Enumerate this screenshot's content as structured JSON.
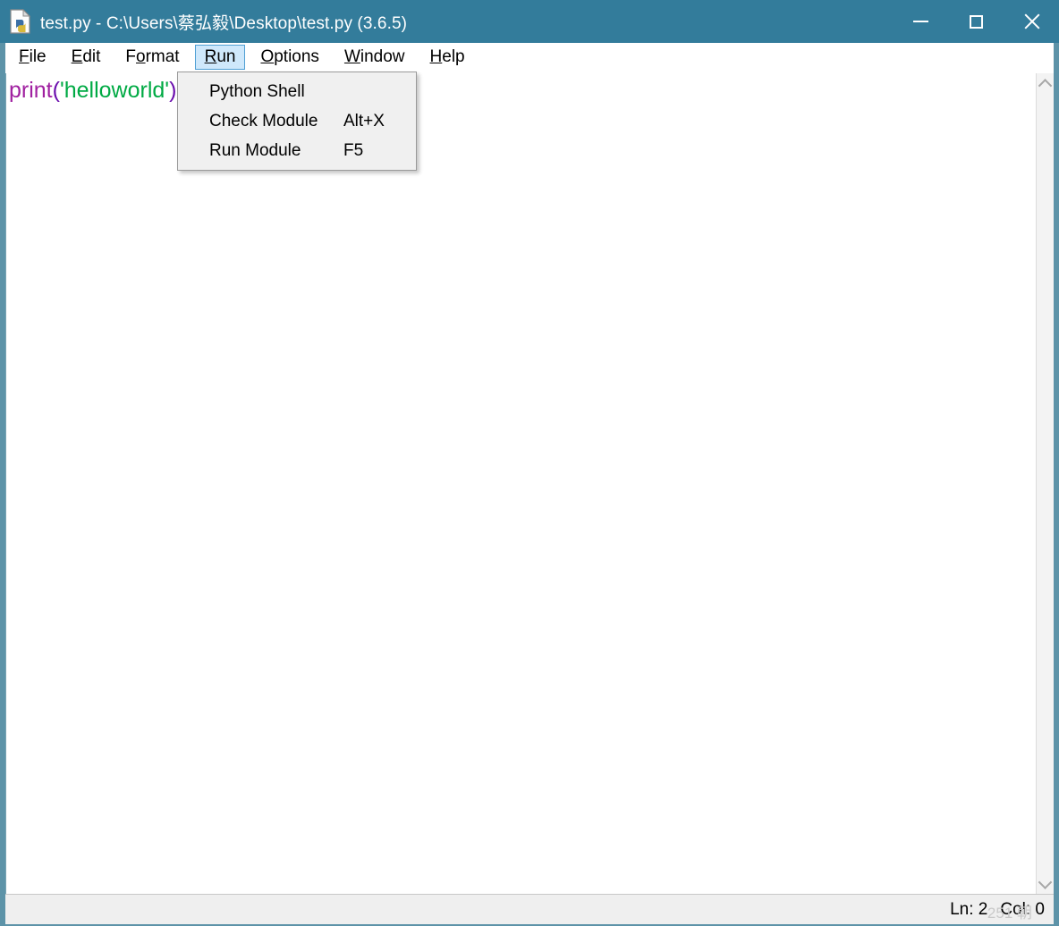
{
  "window": {
    "title": "test.py - C:\\Users\\蔡弘毅\\Desktop\\test.py (3.6.5)",
    "icon": "python-file-icon",
    "titlebar_color": "#337c9b",
    "controls": {
      "minimize_label": "—",
      "maximize_label": "☐",
      "close_label": "✕"
    }
  },
  "menubar": {
    "items": [
      {
        "label": "File",
        "accel": "F",
        "active": false
      },
      {
        "label": "Edit",
        "accel": "E",
        "active": false
      },
      {
        "label": "Format",
        "accel": "o",
        "active": false
      },
      {
        "label": "Run",
        "accel": "R",
        "active": true
      },
      {
        "label": "Options",
        "accel": "O",
        "active": false
      },
      {
        "label": "Window",
        "accel": "W",
        "active": false
      },
      {
        "label": "Help",
        "accel": "H",
        "active": false
      }
    ]
  },
  "dropdown": {
    "owner": "Run",
    "items": [
      {
        "label": "Python Shell",
        "shortcut": ""
      },
      {
        "label": "Check Module",
        "shortcut": "Alt+X"
      },
      {
        "label": "Run Module",
        "shortcut": "F5"
      }
    ]
  },
  "editor": {
    "code": {
      "func": "print",
      "open_paren": "(",
      "string": "'helloworld'",
      "close_paren": ")"
    },
    "colors": {
      "function": "#a020a0",
      "string": "#00aa44",
      "paren": "#6a0dad"
    }
  },
  "scrollbar": {
    "up_icon": "chevron-up-icon",
    "down_icon": "chevron-down-icon"
  },
  "statusbar": {
    "line": "Ln: 2",
    "col": "Col: 0",
    "watermark": "251 朝"
  }
}
